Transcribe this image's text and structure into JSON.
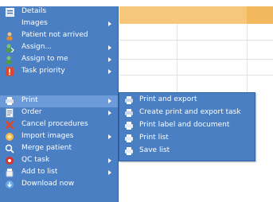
{
  "menu": {
    "items": [
      {
        "label": "Details",
        "icon": "details-icon",
        "arrow": false
      },
      {
        "label": "Images",
        "icon": "images-icon",
        "arrow": true
      },
      {
        "label": "Patient not arrived",
        "icon": "patient-not-arrived-icon",
        "arrow": false
      },
      {
        "label": "Assign...",
        "icon": "assign-icon",
        "arrow": true
      },
      {
        "label": "Assign to me",
        "icon": "assign-to-me-icon",
        "arrow": true
      },
      {
        "label": "Task priority",
        "icon": "task-priority-icon",
        "arrow": true
      },
      {
        "label": "Print",
        "icon": "print-icon",
        "arrow": true,
        "highlighted": true
      },
      {
        "label": "Order",
        "icon": "order-icon",
        "arrow": true
      },
      {
        "label": "Cancel procedures",
        "icon": "cancel-icon",
        "arrow": false
      },
      {
        "label": "Import images",
        "icon": "import-images-icon",
        "arrow": true
      },
      {
        "label": "Merge patient",
        "icon": "merge-patient-icon",
        "arrow": false
      },
      {
        "label": "QC task",
        "icon": "qc-task-icon",
        "arrow": true
      },
      {
        "label": "Add to list",
        "icon": "add-to-list-icon",
        "arrow": true
      },
      {
        "label": "Download now",
        "icon": "download-icon",
        "arrow": false
      }
    ]
  },
  "submenu": {
    "items": [
      {
        "label": "Print and export",
        "icon": "print-export-icon"
      },
      {
        "label": "Create print and export task",
        "icon": "print-task-icon"
      },
      {
        "label": "Print label and document",
        "icon": "printer-icon"
      },
      {
        "label": "Print list",
        "icon": "printer-icon"
      },
      {
        "label": "Save list",
        "icon": "printer-icon"
      }
    ]
  },
  "colors": {
    "menu_bg": "#4a7fc4",
    "menu_highlight": "#6d9ad8",
    "header_orange": "#f6c67a"
  }
}
